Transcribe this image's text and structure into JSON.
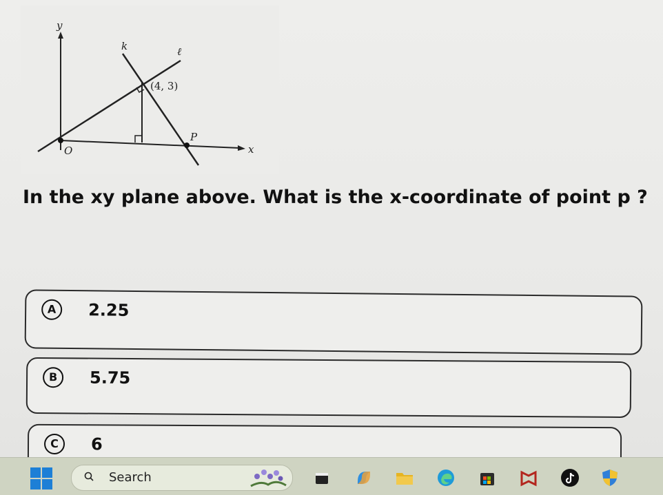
{
  "figure": {
    "axis_y": "y",
    "axis_x": "x",
    "line_k": "k",
    "line_l": "ℓ",
    "point_label": "(4, 3)",
    "point_p": "P",
    "origin": "O"
  },
  "question": {
    "text": "In the  xy plane above. What is the x-coordinate of point p ?"
  },
  "options": [
    {
      "letter": "A",
      "value": "2.25"
    },
    {
      "letter": "B",
      "value": "5.75"
    },
    {
      "letter": "C",
      "value": "6"
    }
  ],
  "taskbar": {
    "search_label": "Search",
    "apps": [
      "app-icon",
      "copilot-icon",
      "file-explorer-icon",
      "edge-icon",
      "store-icon",
      "mcafee-icon",
      "tiktok-icon",
      "security-shield-icon"
    ],
    "colors": {
      "windows_blue": "#1d7fd6",
      "taskbar_bg": "#cfd4c2"
    }
  }
}
